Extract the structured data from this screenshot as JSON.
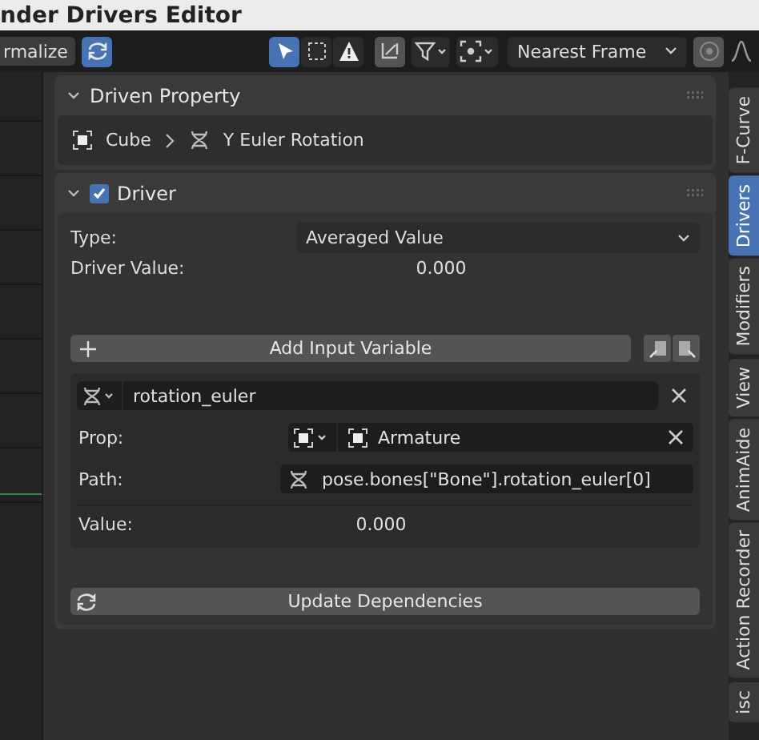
{
  "window": {
    "title": "nder Drivers Editor"
  },
  "toolbar": {
    "normalize_button": "rmalize",
    "auto_normalize": true,
    "tools": [
      {
        "kind": "select",
        "selected": true
      },
      {
        "kind": "box",
        "selected": false
      },
      {
        "kind": "warning",
        "selected": false
      },
      {
        "kind": "crop",
        "selected": false
      }
    ],
    "snap_mode": "Nearest Frame"
  },
  "driven_property": {
    "title": "Driven Property",
    "expanded": true,
    "object": "Cube",
    "property": "Y Euler Rotation"
  },
  "driver": {
    "title": "Driver",
    "expanded": true,
    "enabled": true,
    "type_label": "Type:",
    "type": "Averaged Value",
    "value_label": "Driver Value:",
    "value": "0.000",
    "add_variable": "Add Input Variable",
    "variables": [
      {
        "name": "rotation_euler",
        "prop_label": "Prop:",
        "target": "Armature",
        "path_label": "Path:",
        "path": "pose.bones[\"Bone\"].rotation_euler[0]",
        "value_label": "Value:",
        "value": "0.000"
      }
    ],
    "update_button": "Update Dependencies"
  },
  "sidebar_tabs": [
    {
      "label": "F-Curve",
      "selected": false
    },
    {
      "label": "Drivers",
      "selected": true
    },
    {
      "label": "Modifiers",
      "selected": false
    },
    {
      "label": "View",
      "selected": false
    },
    {
      "label": "AnimAide",
      "selected": false
    },
    {
      "label": "Action Recorder",
      "selected": false
    },
    {
      "label": "isc",
      "selected": false
    }
  ]
}
